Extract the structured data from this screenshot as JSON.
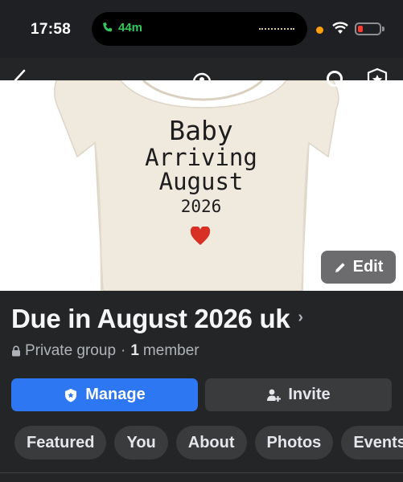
{
  "status_bar": {
    "time": "17:58",
    "call_duration": "44m",
    "icons": [
      "phone-icon",
      "wifi-icon",
      "battery-icon"
    ],
    "battery_color": "#ff3b30",
    "call_color": "#34c759"
  },
  "nav": {
    "icons": [
      "back-icon",
      "group-icon",
      "search-icon",
      "shield-icon"
    ]
  },
  "cover": {
    "lines": [
      "Baby",
      "Arriving",
      "August",
      "2026"
    ],
    "edit_label": "Edit"
  },
  "group": {
    "title": "Due in August 2026 uk",
    "chevron": "›",
    "privacy": "Private group",
    "separator": "·",
    "member_count": "1",
    "member_label": "member"
  },
  "actions": {
    "manage_label": "Manage",
    "invite_label": "Invite",
    "accent": "#2d77f2"
  },
  "tabs": [
    {
      "label": "Featured"
    },
    {
      "label": "You"
    },
    {
      "label": "About"
    },
    {
      "label": "Photos"
    },
    {
      "label": "Events"
    }
  ]
}
